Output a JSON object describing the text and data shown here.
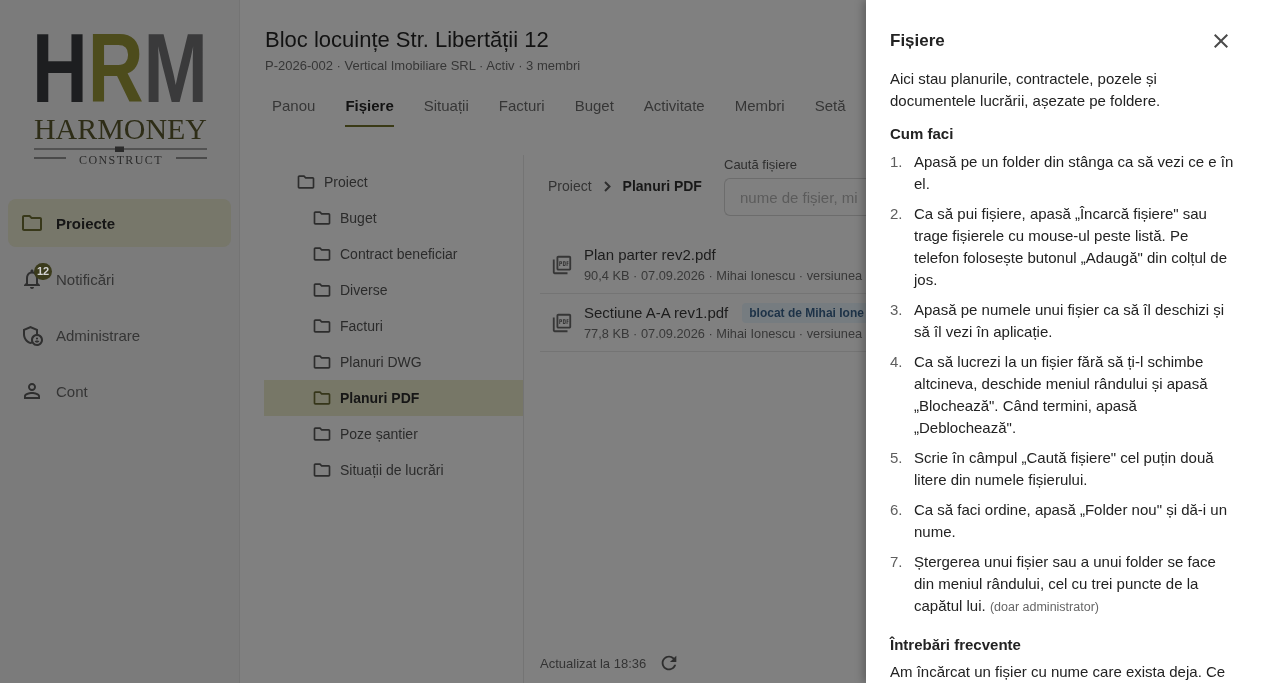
{
  "sidebar": {
    "logo": {
      "monogram": "HRM",
      "wordmark": "HARMONEY",
      "tagline": "CONSTRUCT"
    },
    "items": [
      {
        "label": "Proiecte",
        "selected": true
      },
      {
        "label": "Notificări",
        "selected": false,
        "badge": "12"
      },
      {
        "label": "Administrare",
        "selected": false
      },
      {
        "label": "Cont",
        "selected": false
      }
    ]
  },
  "project": {
    "title": "Bloc locuințe Str. Libertății 12",
    "subtitle": "P-2026-002 · Vertical Imobiliare SRL · Activ · 3 membri"
  },
  "tabs": [
    {
      "label": "Panou",
      "selected": false
    },
    {
      "label": "Fișiere",
      "selected": true
    },
    {
      "label": "Situații",
      "selected": false
    },
    {
      "label": "Facturi",
      "selected": false
    },
    {
      "label": "Buget",
      "selected": false
    },
    {
      "label": "Activitate",
      "selected": false
    },
    {
      "label": "Membri",
      "selected": false
    },
    {
      "label": "Setă",
      "selected": false
    }
  ],
  "folder_tree": [
    {
      "label": "Proiect",
      "selected": false,
      "children": [
        {
          "label": "Buget",
          "selected": false
        },
        {
          "label": "Contract beneficiar",
          "selected": false
        },
        {
          "label": "Diverse",
          "selected": false
        },
        {
          "label": "Facturi",
          "selected": false
        },
        {
          "label": "Planuri DWG",
          "selected": false
        },
        {
          "label": "Planuri PDF",
          "selected": true
        },
        {
          "label": "Poze șantier",
          "selected": false
        },
        {
          "label": "Situații de lucrări",
          "selected": false
        }
      ]
    }
  ],
  "breadcrumb": [
    "Proiect",
    "Planuri PDF"
  ],
  "search": {
    "label": "Caută fișiere",
    "placeholder": "nume de fișier, mi"
  },
  "files": [
    {
      "name": "Plan parter rev2.pdf",
      "details": "90,4 KB · 07.09.2026 · Mihai Ionescu · versiunea"
    },
    {
      "name": "Sectiune A-A rev1.pdf",
      "lock": "blocat de Mihai Ione",
      "details": "77,8 KB · 07.09.2026 · Mihai Ionescu · versiunea"
    }
  ],
  "status_bar": {
    "updated": "Actualizat la 18:36"
  },
  "help_panel": {
    "title": "Fișiere",
    "intro": "Aici stau planurile, contractele, pozele și documentele lucrării, așezate pe foldere.",
    "how_to": {
      "heading": "Cum faci",
      "steps": [
        {
          "number": "1.",
          "text": "Apasă pe un folder din stânga ca să vezi ce e în el."
        },
        {
          "number": "2.",
          "text": "Ca să pui fișiere, apasă „Încarcă fișiere\" sau trage fișierele cu mouse-ul peste listă. Pe telefon folosește butonul „Adaugă\" din colțul de jos."
        },
        {
          "number": "3.",
          "text": "Apasă pe numele unui fișier ca să îl deschizi și să îl vezi în aplicație."
        },
        {
          "number": "4.",
          "text": "Ca să lucrezi la un fișier fără să ți-l schimbe altcineva, deschide meniul rândului și apasă „Blochează\". Când termini, apasă „Deblochează\"."
        },
        {
          "number": "5.",
          "text": "Scrie în câmpul „Caută fișiere\" cel puțin două litere din numele fișierului."
        },
        {
          "number": "6.",
          "text": "Ca să faci ordine, apasă „Folder nou\" și dă-i un nume."
        },
        {
          "number": "7.",
          "text": "Ștergerea unui fișier sau a unui folder se face din meniul rândului, cel cu trei puncte de la capătul lui.",
          "note": "(doar administrator)"
        }
      ]
    },
    "faq": {
      "heading": "Întrebări frecvente",
      "questions": [
        "Am încărcat un fișier cu nume care exista deja. Ce"
      ]
    }
  }
}
